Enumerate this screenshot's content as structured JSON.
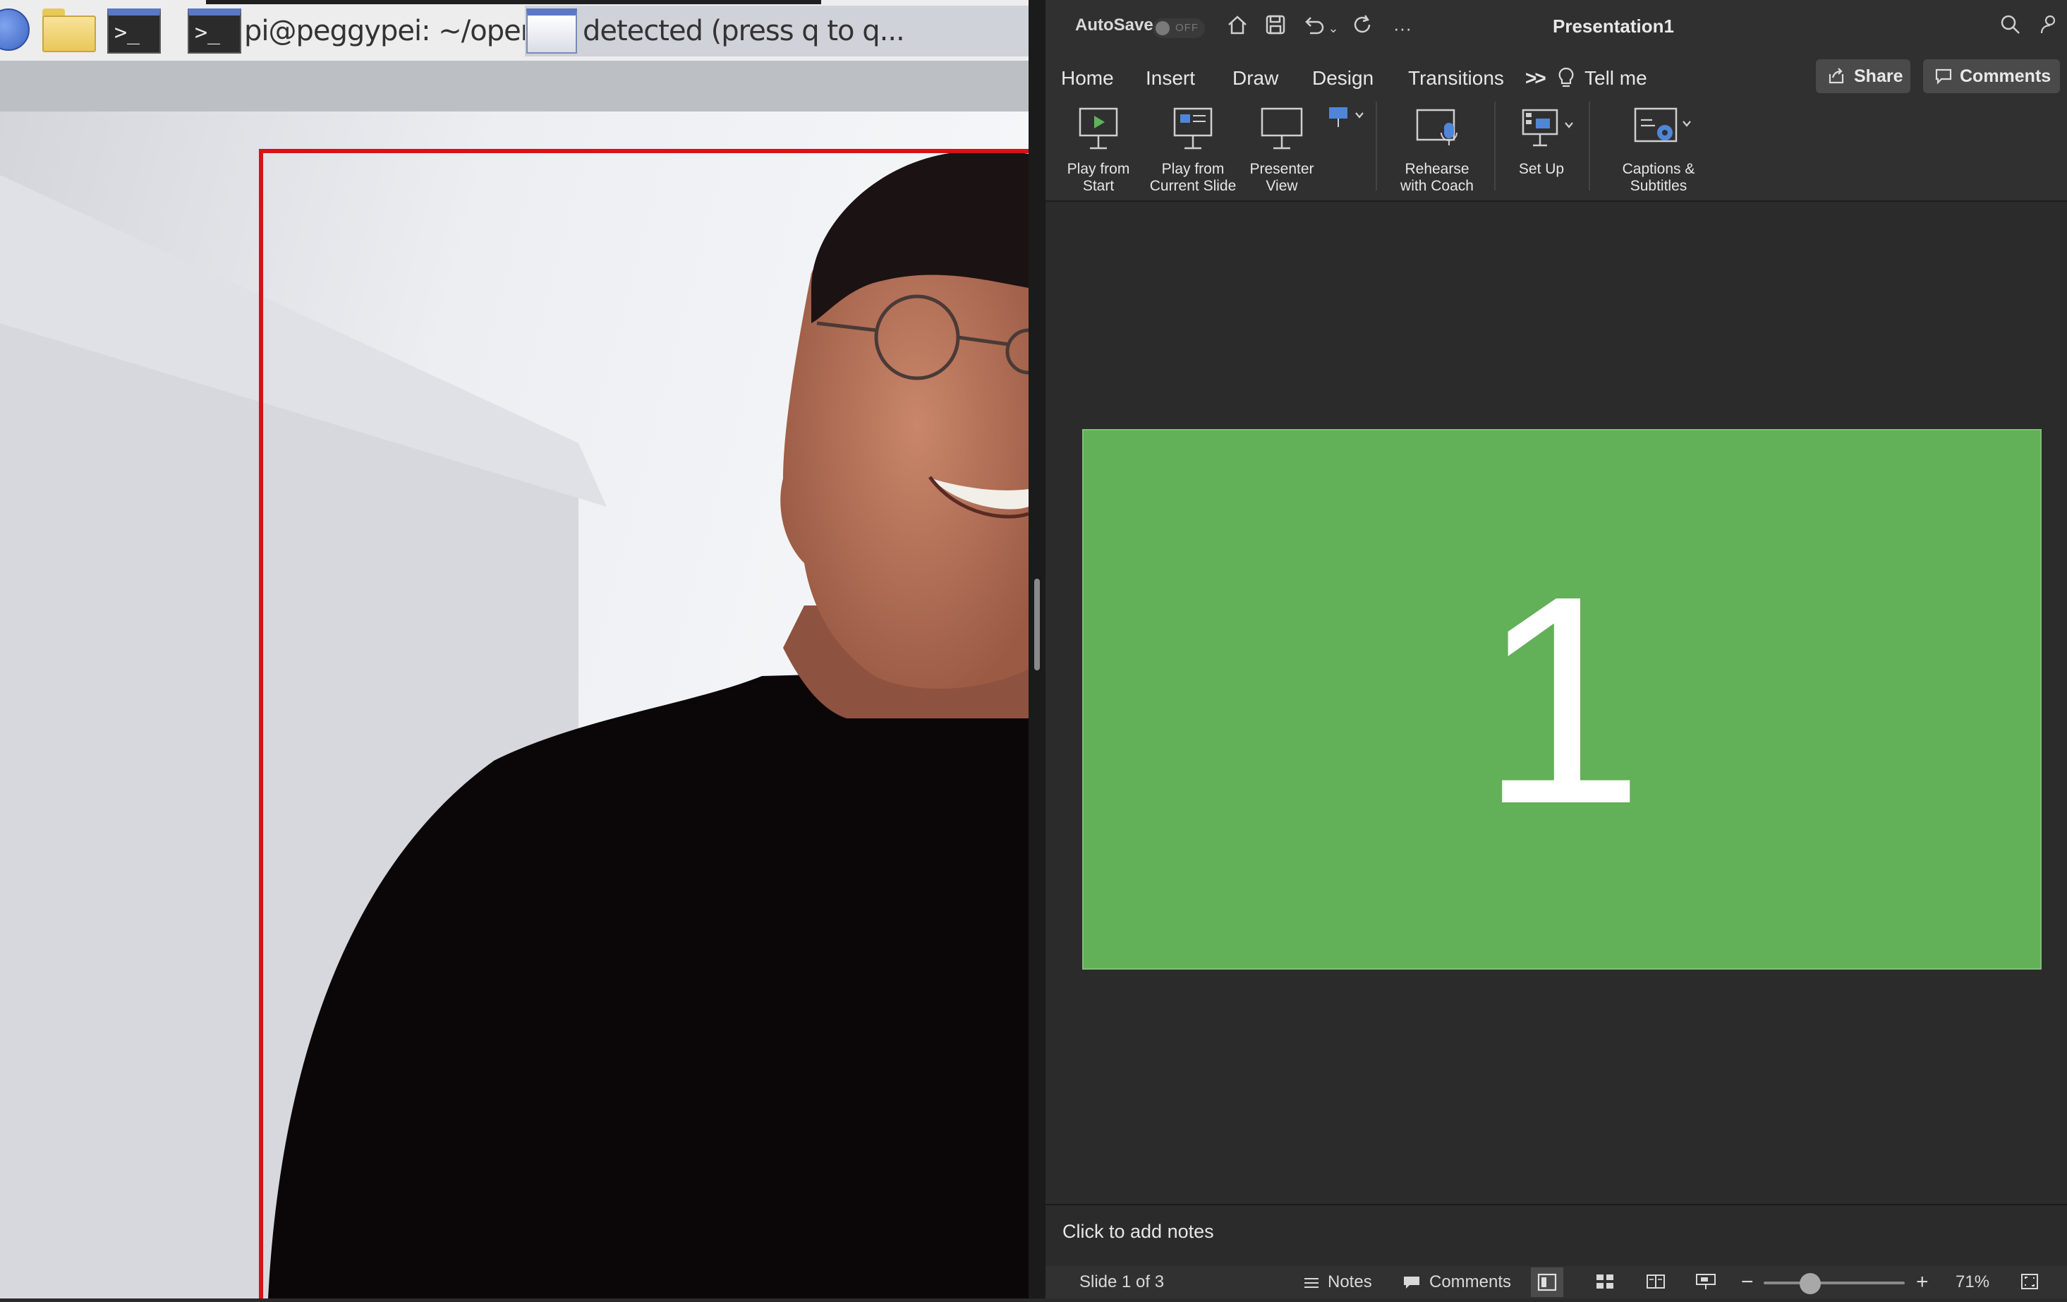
{
  "pi_taskbar": {
    "terminal_glyph": ">_",
    "task1_label": "pi@peggypei: ~/open...",
    "task2_label": "detected (press q to q..."
  },
  "ppt": {
    "titlebar": {
      "autosave_label": "AutoSave",
      "autosave_state": "OFF",
      "title": "Presentation1"
    },
    "tabs": [
      "Home",
      "Insert",
      "Draw",
      "Design",
      "Transitions"
    ],
    "more_tabs_glyph": ">>",
    "tell_me": "Tell me",
    "share_label": "Share",
    "comments_label": "Comments",
    "ribbon": {
      "play_from_start": [
        "Play from",
        "Start"
      ],
      "play_from_current": [
        "Play from",
        "Current Slide"
      ],
      "presenter_view": [
        "Presenter",
        "View"
      ],
      "rehearse": [
        "Rehearse",
        "with Coach"
      ],
      "set_up": [
        "Set Up"
      ],
      "captions": [
        "Captions &",
        "Subtitles"
      ]
    },
    "slide": {
      "number_text": "1",
      "background_color": "#62b058"
    },
    "notes_placeholder": "Click to add notes",
    "status": {
      "slide_indicator": "Slide 1 of 3",
      "notes_label": "Notes",
      "comments_label": "Comments",
      "zoom_minus": "−",
      "zoom_plus": "+",
      "zoom_percent": "71%",
      "zoom_level": 0.71
    }
  }
}
